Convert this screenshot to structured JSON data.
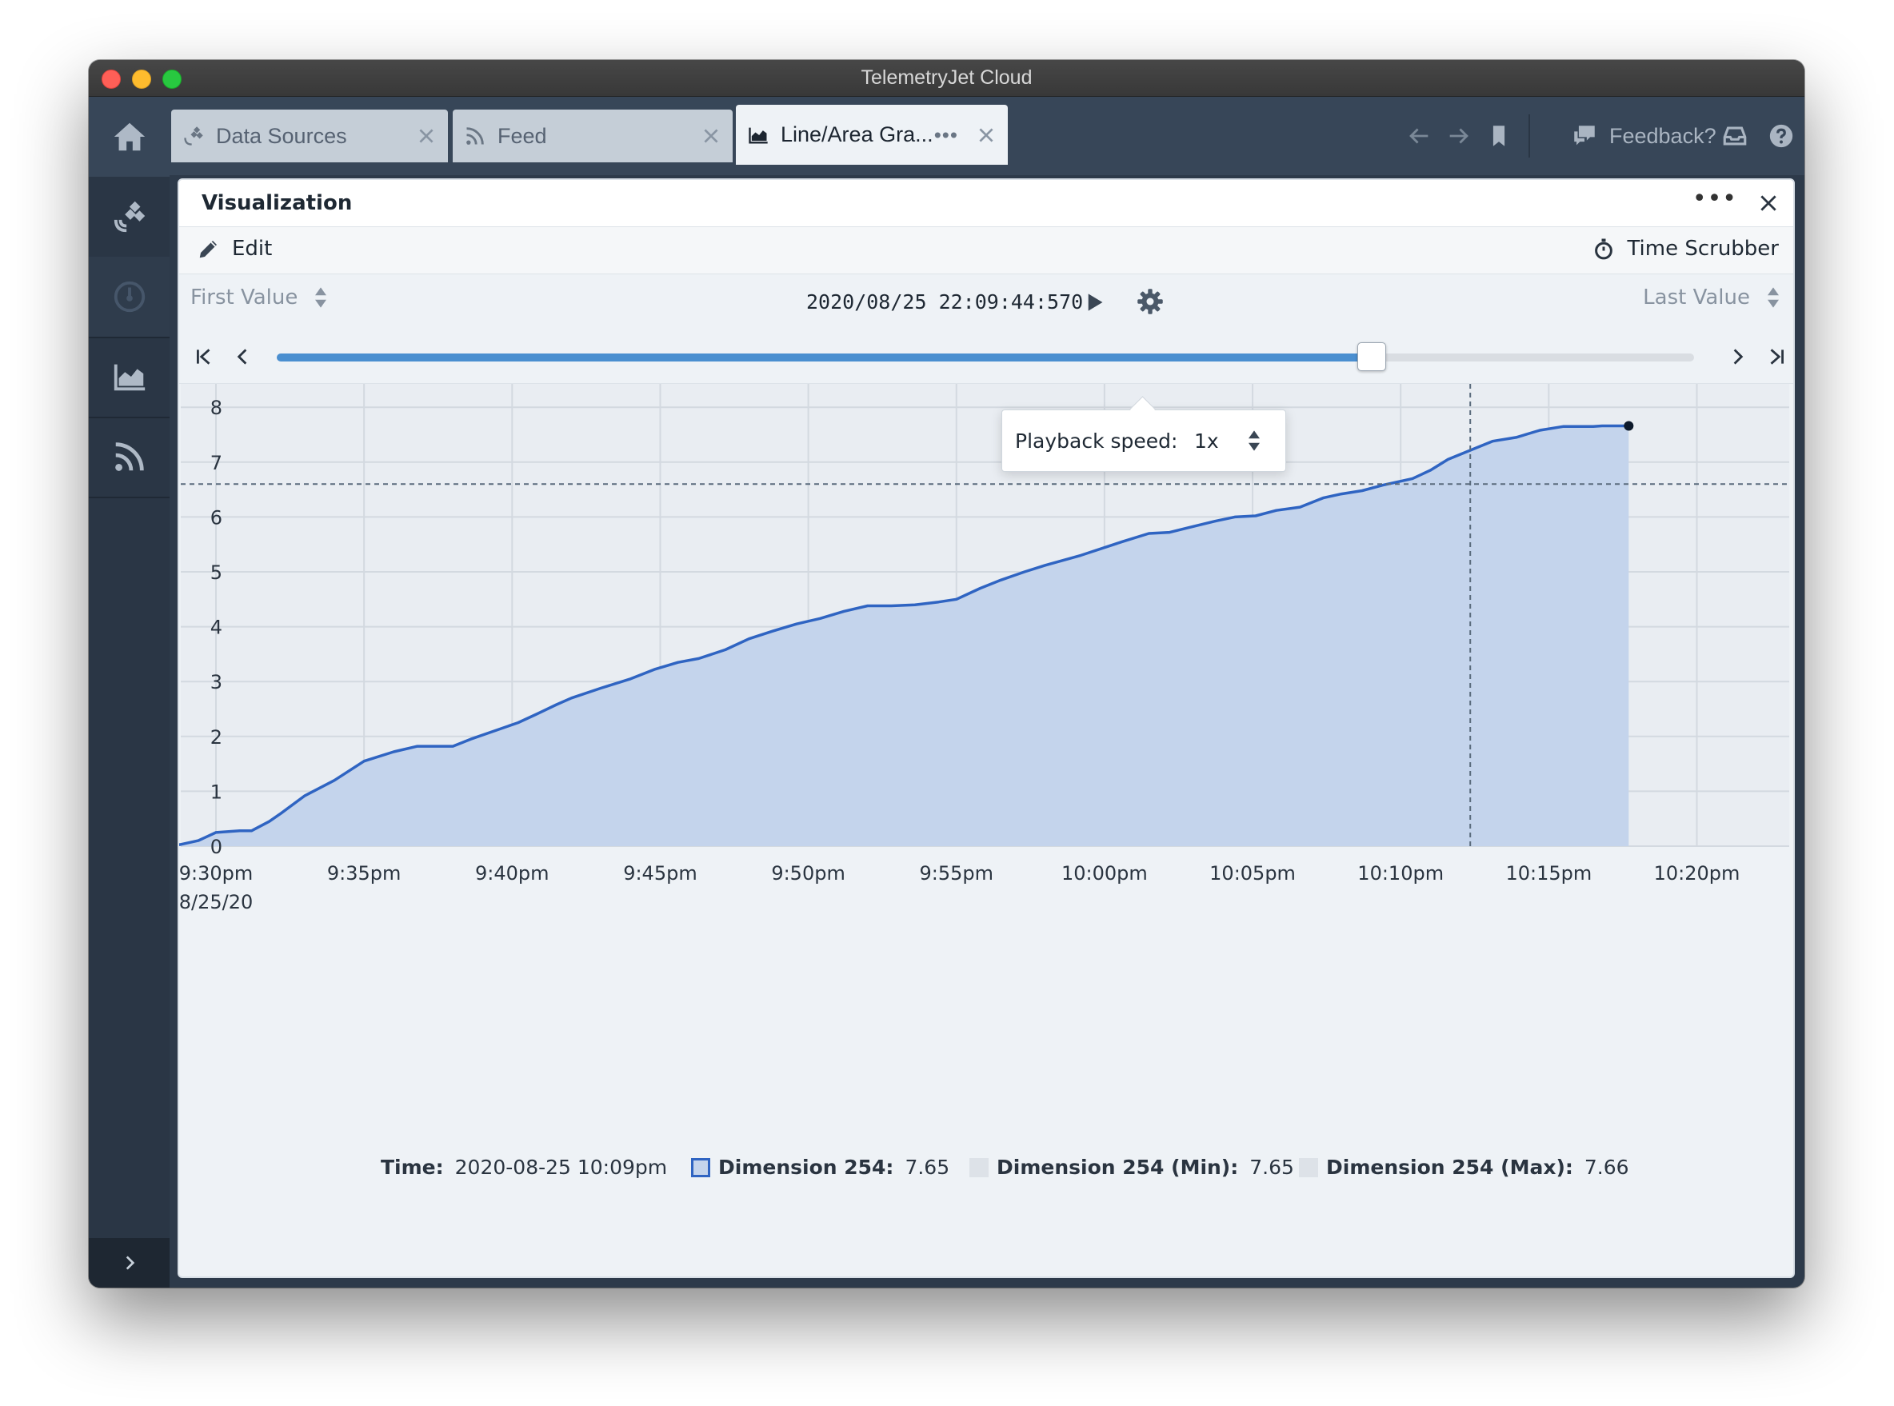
{
  "window": {
    "title": "TelemetryJet Cloud"
  },
  "sidebar": {
    "items": [
      {
        "id": "home",
        "icon": "home-icon"
      },
      {
        "id": "data-sources",
        "icon": "satellite-icon"
      },
      {
        "id": "dashboard",
        "icon": "gauge-icon"
      },
      {
        "id": "charts",
        "icon": "area-chart-icon"
      },
      {
        "id": "feed",
        "icon": "rss-icon"
      }
    ],
    "expand_icon": "chevron-right-icon"
  },
  "tabs": [
    {
      "label": "Data Sources",
      "icon": "satellite-icon",
      "active": false
    },
    {
      "label": "Feed",
      "icon": "rss-icon",
      "active": false
    },
    {
      "label": "Line/Area Gra...",
      "icon": "area-chart-icon",
      "active": true
    }
  ],
  "topbar": {
    "feedback_label": "Feedback?"
  },
  "panel": {
    "title": "Visualization",
    "edit_label": "Edit",
    "time_scrubber_label": "Time Scrubber"
  },
  "scrubber": {
    "start_mode": "First Value",
    "end_mode": "Last Value",
    "timestamp": "2020/08/25 22:09:44:570",
    "progress": 0.772
  },
  "popover": {
    "label": "Playback speed:",
    "value": "1x"
  },
  "chart_data": {
    "type": "area",
    "ylim": [
      0,
      8
    ],
    "yticks": [
      "0",
      "1",
      "2",
      "3",
      "4",
      "5",
      "6",
      "7",
      "8"
    ],
    "xticks": [
      "9:30pm",
      "9:35pm",
      "9:40pm",
      "9:45pm",
      "9:50pm",
      "9:55pm",
      "10:00pm",
      "10:05pm",
      "10:10pm",
      "10:15pm",
      "10:20pm"
    ],
    "xtick_sublabel": "8/25/20",
    "xlim_minutes": [
      0,
      50
    ],
    "crosshair_minute": 42.35,
    "crosshair_value": 6.6,
    "series": [
      {
        "name": "Dimension 254",
        "color": "#2f64c2",
        "fill": "#c4d4ec",
        "x_minutes": [
          -1.6,
          -1.2,
          -0.6,
          0,
          0.8,
          1.2,
          1.8,
          2.2,
          3,
          4,
          5,
          6,
          6.8,
          7.3,
          8,
          8.6,
          9.5,
          10.2,
          10.8,
          11.5,
          12,
          13,
          14,
          14.8,
          15.6,
          16.3,
          17.2,
          18,
          18.8,
          19.6,
          20.4,
          21.2,
          22,
          22.8,
          23.6,
          24.4,
          25,
          25.8,
          26.5,
          27.3,
          28,
          29.2,
          30.6,
          31.5,
          32.2,
          32.8,
          33.7,
          34.4,
          35.1,
          35.8,
          36.6,
          37.4,
          38,
          38.7,
          39.4,
          40.4,
          41,
          41.6,
          42.5,
          43.1,
          43.9,
          44.7,
          45.5,
          45.9,
          46.5,
          46.8,
          47.7
        ],
        "values": [
          0,
          0.03,
          0.1,
          0.25,
          0.28,
          0.28,
          0.45,
          0.6,
          0.92,
          1.2,
          1.55,
          1.72,
          1.82,
          1.82,
          1.82,
          1.95,
          2.12,
          2.25,
          2.4,
          2.58,
          2.7,
          2.88,
          3.05,
          3.22,
          3.35,
          3.42,
          3.58,
          3.78,
          3.92,
          4.05,
          4.15,
          4.28,
          4.38,
          4.38,
          4.4,
          4.45,
          4.5,
          4.7,
          4.85,
          5.0,
          5.12,
          5.3,
          5.55,
          5.7,
          5.72,
          5.8,
          5.92,
          6.0,
          6.02,
          6.12,
          6.18,
          6.35,
          6.42,
          6.48,
          6.58,
          6.7,
          6.85,
          7.05,
          7.25,
          7.38,
          7.45,
          7.58,
          7.65,
          7.65,
          7.65,
          7.66,
          7.66
        ]
      }
    ],
    "legend": {
      "time_label": "Time:",
      "time_value": "2020-08-25 10:09pm",
      "items": [
        {
          "label": "Dimension 254:",
          "value": "7.65",
          "swatch": "#2f64c2",
          "swatch_style": "outline"
        },
        {
          "label": "Dimension 254 (Min):",
          "value": "7.65",
          "swatch": "#dde2e8",
          "swatch_style": "solid"
        },
        {
          "label": "Dimension 254 (Max):",
          "value": "7.66",
          "swatch": "#dde2e8",
          "swatch_style": "solid"
        }
      ]
    }
  }
}
